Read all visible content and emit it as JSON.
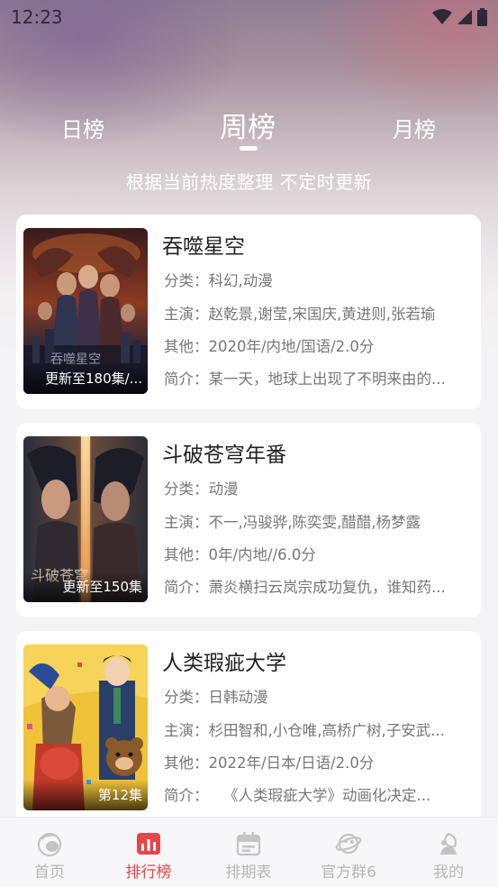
{
  "status_bar": {
    "time": "12:23"
  },
  "tabs": {
    "day": "日榜",
    "week": "周榜",
    "month": "月榜",
    "active": "week"
  },
  "subtitle": "根据当前热度整理 不定时更新",
  "cards": [
    {
      "title": "吞噬星空",
      "badge": "更新至180集/...",
      "genre": "分类：科幻,动漫",
      "cast": "主演：赵乾景,谢莹,宋国庆,黄进则,张若瑜",
      "other": "其他：2020年/内地/国语/2.0分",
      "intro": "简介：某一天，地球上出现了不明来由的..."
    },
    {
      "title": "斗破苍穹年番",
      "badge": "更新至150集",
      "genre": "分类：动漫",
      "cast": "主演：不一,冯骏骅,陈奕雯,醋醋,杨梦露",
      "other": "其他：0年/内地//6.0分",
      "intro": "简介：萧炎横扫云岚宗成功复仇，谁知药..."
    },
    {
      "title": "人类瑕疵大学",
      "badge": "第12集",
      "genre": "分类：日韩动漫",
      "cast": "主演：杉田智和,小仓唯,高桥广树,子安武...",
      "other": "其他：2022年/日本/日语/2.0分",
      "intro": "简介：　　《人类瑕疵大学》动画化决定..."
    }
  ],
  "nav": {
    "home": "首页",
    "ranking": "排行榜",
    "schedule": "排期表",
    "group": "官方群6",
    "mine": "我的",
    "active": "ranking",
    "accent_color": "#e4464a",
    "inactive_color": "#b6b5b8"
  }
}
